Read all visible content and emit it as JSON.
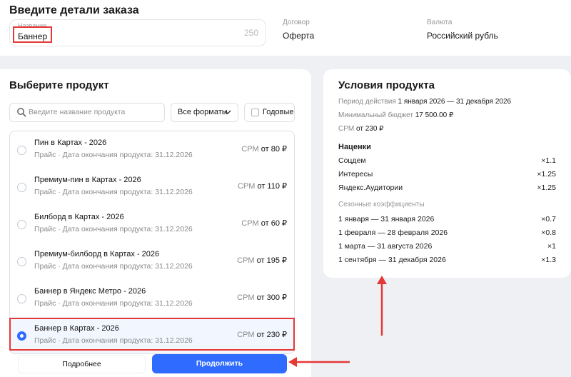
{
  "order": {
    "title": "Введите детали заказа",
    "name_label": "Название",
    "name_value": "Баннер",
    "name_counter": "250",
    "contract_label": "Договор",
    "contract_value": "Оферта",
    "currency_label": "Валюта",
    "currency_value": "Российский рубль"
  },
  "product_select": {
    "title": "Выберите продукт",
    "search_placeholder": "Введите название продукта",
    "formats_label": "Все форматы",
    "yearly_label": "Годовые",
    "items": [
      {
        "name": "Пин в Картах - 2026",
        "subtitle": "Прайс · Дата окончания продукта: 31.12.2026",
        "price_prefix": "CPM",
        "price": "от 80 ₽",
        "selected": false
      },
      {
        "name": "Премиум-пин в Картах - 2026",
        "subtitle": "Прайс · Дата окончания продукта: 31.12.2026",
        "price_prefix": "CPM",
        "price": "от 110 ₽",
        "selected": false
      },
      {
        "name": "Билборд в Картах - 2026",
        "subtitle": "Прайс · Дата окончания продукта: 31.12.2026",
        "price_prefix": "CPM",
        "price": "от 60 ₽",
        "selected": false
      },
      {
        "name": "Премиум-билборд в Картах - 2026",
        "subtitle": "Прайс · Дата окончания продукта: 31.12.2026",
        "price_prefix": "CPM",
        "price": "от 195 ₽",
        "selected": false
      },
      {
        "name": "Баннер в Яндекс Метро - 2026",
        "subtitle": "Прайс · Дата окончания продукта: 31.12.2026",
        "price_prefix": "CPM",
        "price": "от 300 ₽",
        "selected": false
      },
      {
        "name": "Баннер в Картах - 2026",
        "subtitle": "Прайс · Дата окончания продукта: 31.12.2026",
        "price_prefix": "CPM",
        "price": "от 230 ₽",
        "selected": true
      }
    ],
    "more_button": "Подробнее",
    "continue_button": "Продолжить"
  },
  "conditions": {
    "title": "Условия продукта",
    "period_label": "Период действия",
    "period_value": "1 января 2026 — 31 декабря 2026",
    "budget_label": "Минимальный бюджет",
    "budget_value": "17 500.00 ₽",
    "cpm_label": "CPM",
    "cpm_value": "от 230 ₽",
    "markups_title": "Наценки",
    "markups": [
      {
        "name": "Соцдем",
        "value": "×1.1"
      },
      {
        "name": "Интересы",
        "value": "×1.25"
      },
      {
        "name": "Яндекс.Аудитории",
        "value": "×1.25"
      }
    ],
    "seasonal_title": "Сезонные коэффициенты",
    "seasonal": [
      {
        "name": "1 января — 31 января 2026",
        "value": "×0.7"
      },
      {
        "name": "1 февраля — 28 февраля 2026",
        "value": "×0.8"
      },
      {
        "name": "1 марта — 31 августа 2026",
        "value": "×1"
      },
      {
        "name": "1 сентября — 31 декабря 2026",
        "value": "×1.3"
      }
    ]
  },
  "colors": {
    "accent": "#2f6bff",
    "annotation": "#e53935",
    "background": "#eef0f4"
  }
}
